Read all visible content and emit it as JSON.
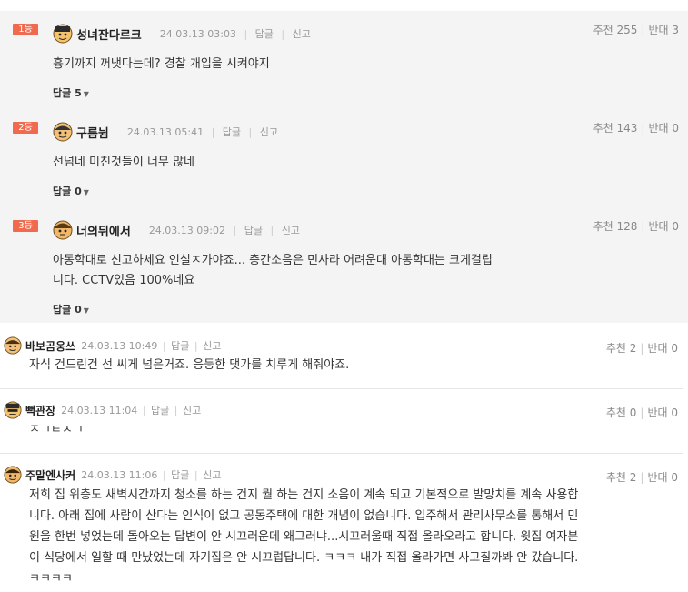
{
  "best_comments": [
    {
      "rank": "1등",
      "nick": "성녀잔다르크",
      "date": "24.03.13 03:03",
      "reply_action": "답글",
      "report_action": "신고",
      "up_label": "추천",
      "up_count": "255",
      "down_label": "반대",
      "down_count": "3",
      "text": "흉기까지 꺼냇다는데? 경찰 개입을 시켜야지",
      "replies": "답글 5"
    },
    {
      "rank": "2등",
      "nick": "구름뉨",
      "date": "24.03.13 05:41",
      "reply_action": "답글",
      "report_action": "신고",
      "up_label": "추천",
      "up_count": "143",
      "down_label": "반대",
      "down_count": "0",
      "text": "선넘네 미친것들이 너무 많네",
      "replies": "답글 0"
    },
    {
      "rank": "3등",
      "nick": "너의뒤에서",
      "date": "24.03.13 09:02",
      "reply_action": "답글",
      "report_action": "신고",
      "up_label": "추천",
      "up_count": "128",
      "down_label": "반대",
      "down_count": "0",
      "text_line1": "아동학대로 신고하세요 인실ㅈ가야죠... 층간소음은 민사라 어려운대 아동학대는 크게걸립",
      "text_line2": "니다. CCTV있음 100%네요",
      "replies": "답글 0"
    }
  ],
  "comments": [
    {
      "nick": "바보곰웅쓰",
      "date": "24.03.13 10:49",
      "reply_action": "답글",
      "report_action": "신고",
      "up_label": "추천",
      "up_count": "2",
      "down_label": "반대",
      "down_count": "0",
      "text": "자식 건드린건 선 씨게 넘은거죠. 응등한 댓가를 치루게 해줘야죠."
    },
    {
      "nick": "뻑관장",
      "date": "24.03.13 11:04",
      "reply_action": "답글",
      "report_action": "신고",
      "up_label": "추천",
      "up_count": "0",
      "down_label": "반대",
      "down_count": "0",
      "text": "ㅈㄱㅌㅅㄱ"
    },
    {
      "nick": "주말엔사커",
      "date": "24.03.13 11:06",
      "reply_action": "답글",
      "report_action": "신고",
      "up_label": "추천",
      "up_count": "2",
      "down_label": "반대",
      "down_count": "0",
      "lines": [
        "저희 집 위층도 새벽시간까지 청소를 하는 건지 뭘 하는 건지 소음이 계속 되고 기본적으로 발망치를 계속 사용합",
        "니다. 아래 집에 사람이 산다는 인식이 없고 공동주택에 대한 개념이 없습니다. 입주해서 관리사무소를 통해서 민",
        "원을 한번 넣었는데 돌아오는 답변이 안 시끄러운데 왜그러냐...시끄러울때 직접 올라오라고 합니다. 윗집 여자분",
        "이 식당에서 일할 때 만났었는데 자기집은 안 시끄럽답니다. ㅋㅋㅋ 내가 직접 올라가면 사고칠까봐 안 갔습니다.",
        "ㅋㅋㅋㅋ"
      ]
    }
  ],
  "colors": {
    "rank_badge": "#f16a4d",
    "best_bg": "#f4f4f4"
  }
}
